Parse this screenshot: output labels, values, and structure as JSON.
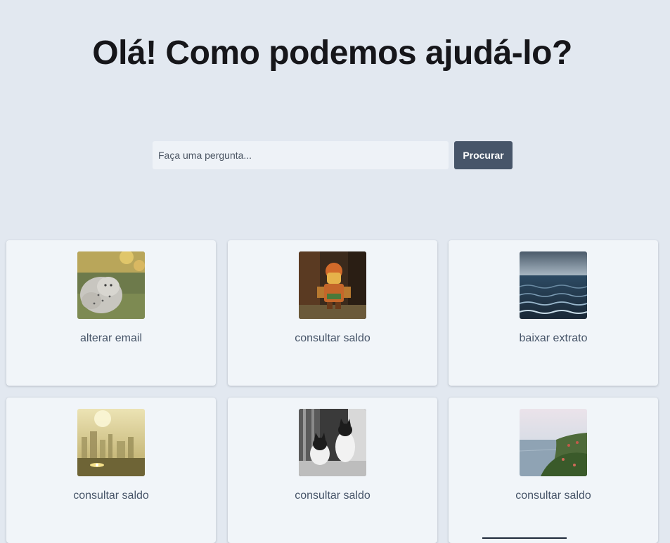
{
  "header": {
    "title": "Olá! Como podemos ajudá-lo?"
  },
  "search": {
    "placeholder": "Faça uma pergunta...",
    "value": "",
    "button_label": "Procurar"
  },
  "cards": [
    {
      "label": "alterar email",
      "image": "snow-leopard-cubs-photo"
    },
    {
      "label": "consultar saldo",
      "image": "lego-minifigure-photo"
    },
    {
      "label": "baixar extrato",
      "image": "ocean-waves-photo"
    },
    {
      "label": "consultar saldo",
      "image": "hazy-city-skyline-photo"
    },
    {
      "label": "consultar saldo",
      "image": "black-white-cats-photo"
    },
    {
      "label": "consultar saldo",
      "image": "coastal-cliff-photo"
    }
  ],
  "colors": {
    "page_background": "#e2e8f0",
    "card_background": "#f1f5f9",
    "button_background": "#475569",
    "title_text": "#16161a",
    "card_text": "#475569"
  }
}
